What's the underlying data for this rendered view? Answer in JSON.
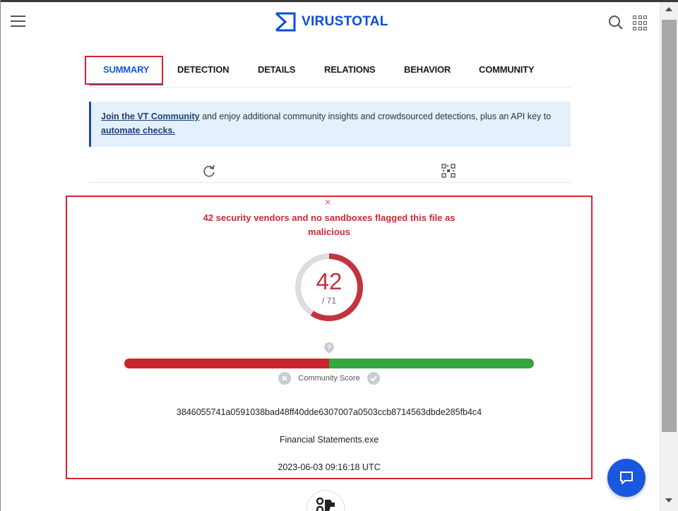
{
  "header": {
    "brand": "VIRUSTOTAL",
    "menu_icon": "hamburger-menu-icon",
    "search_icon": "search-icon",
    "apps_icon": "apps-grid-icon"
  },
  "tabs": [
    {
      "label": "SUMMARY",
      "active": true
    },
    {
      "label": "DETECTION",
      "active": false
    },
    {
      "label": "DETAILS",
      "active": false
    },
    {
      "label": "RELATIONS",
      "active": false
    },
    {
      "label": "BEHAVIOR",
      "active": false
    },
    {
      "label": "COMMUNITY",
      "active": false
    }
  ],
  "banner": {
    "link1": "Join the VT Community",
    "text1": " and enjoy additional community insights and crowdsourced detections, plus an API key to ",
    "link2": "automate checks."
  },
  "detection": {
    "close_glyph": "×",
    "verdict": "42 security vendors and no sandboxes flagged this file as malicious",
    "score": "42",
    "total": "/ 71",
    "detection_fraction": 0.5915,
    "community_label": "Community Score",
    "community_negative_fraction": 0.5,
    "hash": "3846055741a0591038bad48ff40dde6307007a0503ccb8714563dbde285fb4c4",
    "filename": "Financial Statements.exe",
    "timestamp": "2023-06-03 09:16:18 UTC"
  },
  "colors": {
    "accent": "#1a57e0",
    "malicious": "#c7252d",
    "harmless": "#35a641",
    "highlight_box": "#d62430"
  }
}
